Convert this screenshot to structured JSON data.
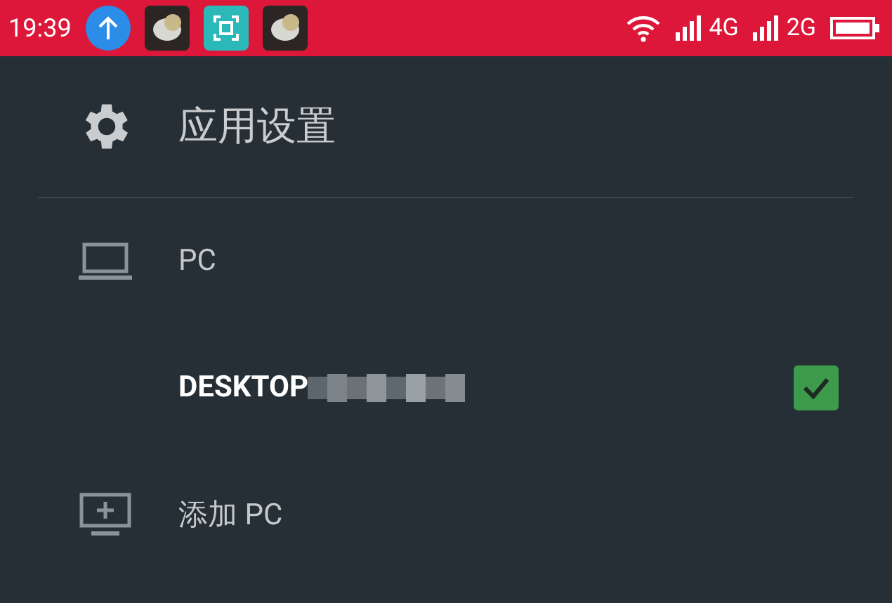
{
  "status_bar": {
    "time": "19:39",
    "networks": [
      "4G",
      "2G"
    ]
  },
  "header": {
    "title": "应用设置"
  },
  "items": [
    {
      "kind": "section",
      "label": "PC"
    },
    {
      "kind": "device",
      "label": "DESKTOP",
      "checked": true
    },
    {
      "kind": "action",
      "label": "添加 PC"
    }
  ]
}
